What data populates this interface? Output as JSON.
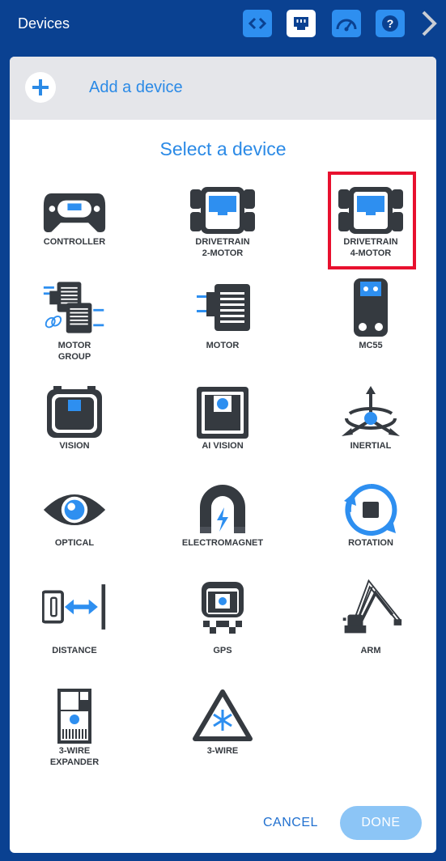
{
  "topbar": {
    "title": "Devices",
    "buttons": [
      {
        "icon": "code-icon",
        "active": false
      },
      {
        "icon": "ports-icon",
        "active": true
      },
      {
        "icon": "dashboard-icon",
        "active": false
      },
      {
        "icon": "help-icon",
        "active": false
      }
    ],
    "next_icon": "chevron-right-icon"
  },
  "add_device": {
    "label": "Add a device",
    "icon": "plus-icon"
  },
  "heading": "Select a device",
  "devices": [
    {
      "line1": "CONTROLLER",
      "line2": "",
      "icon": "controller-icon"
    },
    {
      "line1": "DRIVETRAIN",
      "line2": "2-MOTOR",
      "icon": "drivetrain-2-motor-icon"
    },
    {
      "line1": "DRIVETRAIN",
      "line2": "4-MOTOR",
      "icon": "drivetrain-4-motor-icon",
      "selected": true
    },
    {
      "line1": "MOTOR",
      "line2": "GROUP",
      "icon": "motor-group-icon"
    },
    {
      "line1": "MOTOR",
      "line2": "",
      "icon": "motor-icon"
    },
    {
      "line1": "MC55",
      "line2": "",
      "icon": "mc55-icon"
    },
    {
      "line1": "VISION",
      "line2": "",
      "icon": "vision-icon"
    },
    {
      "line1": "AI VISION",
      "line2": "",
      "icon": "ai-vision-icon"
    },
    {
      "line1": "INERTIAL",
      "line2": "",
      "icon": "inertial-icon"
    },
    {
      "line1": "OPTICAL",
      "line2": "",
      "icon": "optical-icon"
    },
    {
      "line1": "ELECTROMAGNET",
      "line2": "",
      "icon": "electromagnet-icon"
    },
    {
      "line1": "ROTATION",
      "line2": "",
      "icon": "rotation-icon"
    },
    {
      "line1": "DISTANCE",
      "line2": "",
      "icon": "distance-icon"
    },
    {
      "line1": "GPS",
      "line2": "",
      "icon": "gps-icon"
    },
    {
      "line1": "ARM",
      "line2": "",
      "icon": "arm-icon"
    },
    {
      "line1": "3-WIRE",
      "line2": "EXPANDER",
      "icon": "3-wire-expander-icon"
    },
    {
      "line1": "3-WIRE",
      "line2": "",
      "icon": "3-wire-icon"
    }
  ],
  "footer": {
    "cancel": "CANCEL",
    "done": "DONE"
  },
  "colors": {
    "brand": "#0a4191",
    "accent": "#2b8ae6",
    "icon_dark": "#353a40",
    "icon_blue": "#2e8ff0",
    "selected_border": "#e8102e"
  }
}
